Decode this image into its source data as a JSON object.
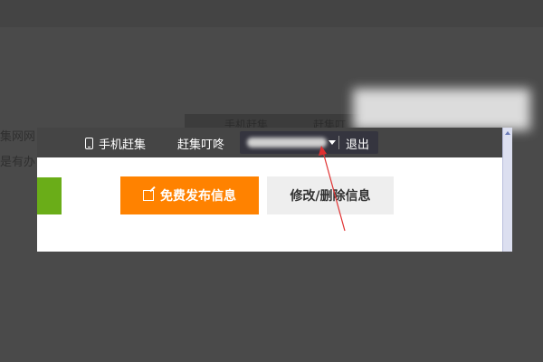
{
  "background": {
    "left_text_1": "集网网",
    "left_text_2": "是有办",
    "strip_item_1": "手机赶集",
    "strip_item_2": "赶集叮"
  },
  "topbar": {
    "mobile_label": "手机赶集",
    "ding_label": "赶集叮咚",
    "username_redacted": true,
    "logout_label": "退出"
  },
  "actions": {
    "post_label": "免费发布信息",
    "edit_label": "修改/删除信息"
  },
  "colors": {
    "topbar_bg": "#454545",
    "post_button": "#ff8200",
    "green_accent": "#6aad18",
    "annotation_arrow": "#e03030"
  },
  "icons": {
    "mobile": "phone-icon",
    "post": "edit-icon",
    "user_menu": "caret-down-icon"
  }
}
